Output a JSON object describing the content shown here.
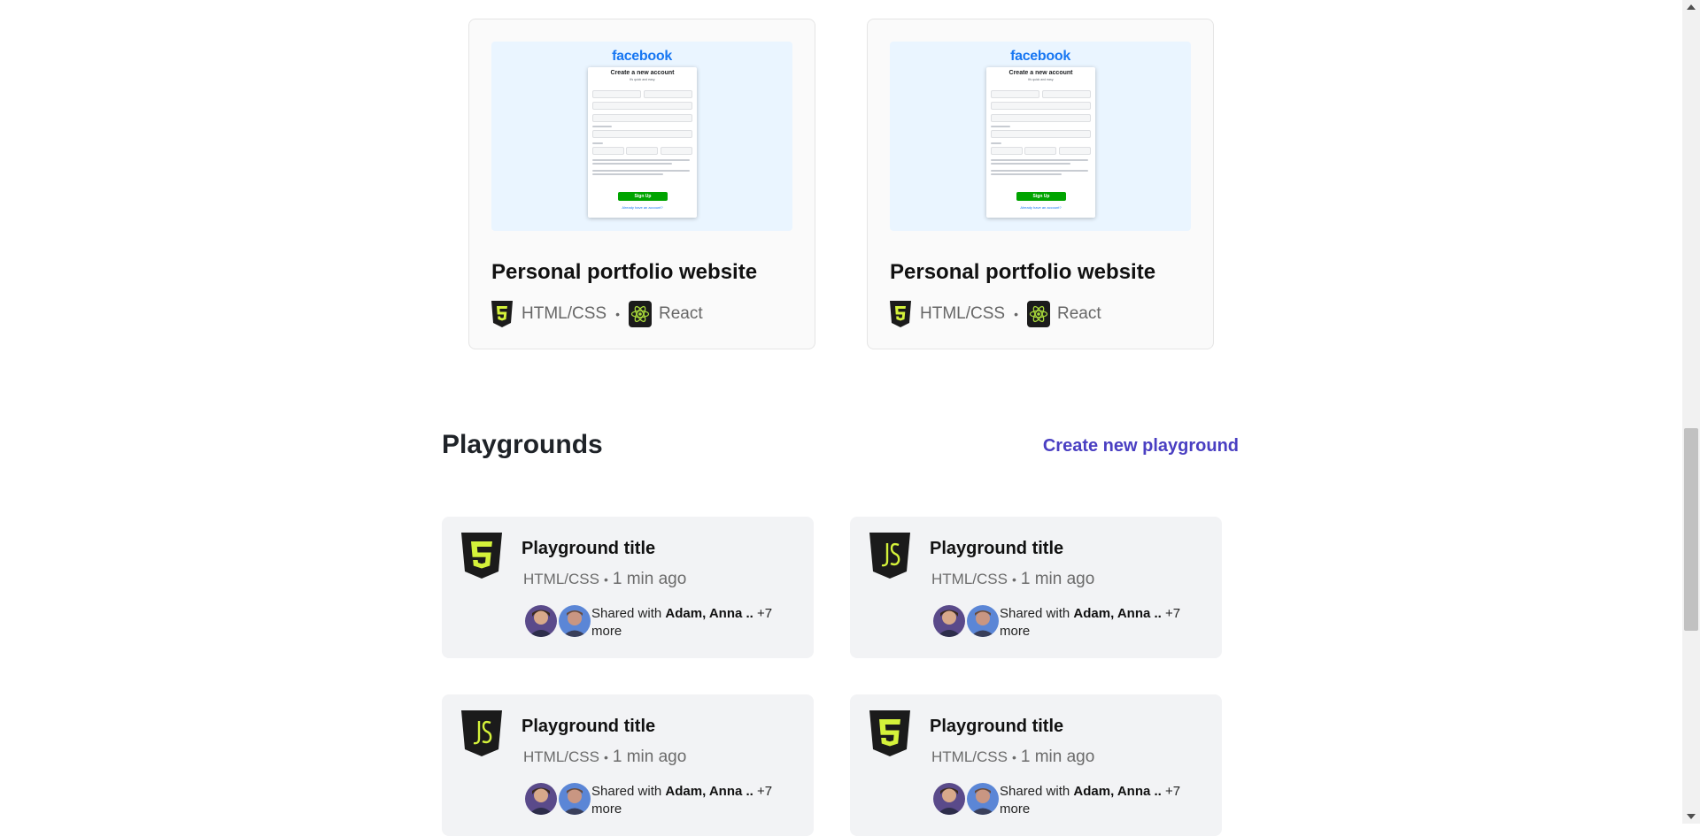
{
  "projects": [
    {
      "thumbnail": {
        "brand": "facebook",
        "heading": "Create a new account",
        "subheading": "It's quick and easy.",
        "button": "Sign Up",
        "link": "Already have an account?"
      },
      "title": "Personal portfolio website",
      "tech1": "HTML/CSS",
      "separator": "•",
      "tech2": "React"
    },
    {
      "thumbnail": {
        "brand": "facebook",
        "heading": "Create a new account",
        "subheading": "It's quick and easy.",
        "button": "Sign Up",
        "link": "Already have an account?"
      },
      "title": "Personal portfolio website",
      "tech1": "HTML/CSS",
      "separator": "•",
      "tech2": "React"
    }
  ],
  "playgrounds_section": {
    "title": "Playgrounds",
    "create_link": "Create new playground"
  },
  "playgrounds": [
    {
      "icon": "html5-icon",
      "title": "Playground title",
      "lang": "HTML/CSS",
      "dot": "•",
      "time": "1 min ago",
      "shared_prefix": "Shared with ",
      "shared_names": "Adam, Anna ..",
      "shared_more": " +7 more"
    },
    {
      "icon": "javascript-icon",
      "title": "Playground title",
      "lang": "HTML/CSS",
      "dot": "•",
      "time": "1 min ago",
      "shared_prefix": "Shared with ",
      "shared_names": "Adam, Anna ..",
      "shared_more": " +7 more"
    },
    {
      "icon": "javascript-icon",
      "title": "Playground title",
      "lang": "HTML/CSS",
      "dot": "•",
      "time": "1 min ago",
      "shared_prefix": "Shared with ",
      "shared_names": "Adam, Anna ..",
      "shared_more": " +7 more"
    },
    {
      "icon": "html5-icon",
      "title": "Playground title",
      "lang": "HTML/CSS",
      "dot": "•",
      "time": "1 min ago",
      "shared_prefix": "Shared with ",
      "shared_names": "Adam, Anna ..",
      "shared_more": " +7 more"
    }
  ],
  "colors": {
    "accent_link": "#4a3fc2",
    "icon_badge": "#1b1b1b",
    "icon_glyph": "#d4f23a",
    "card_bg": "#f2f3f5",
    "facebook_blue": "#1877f2"
  }
}
